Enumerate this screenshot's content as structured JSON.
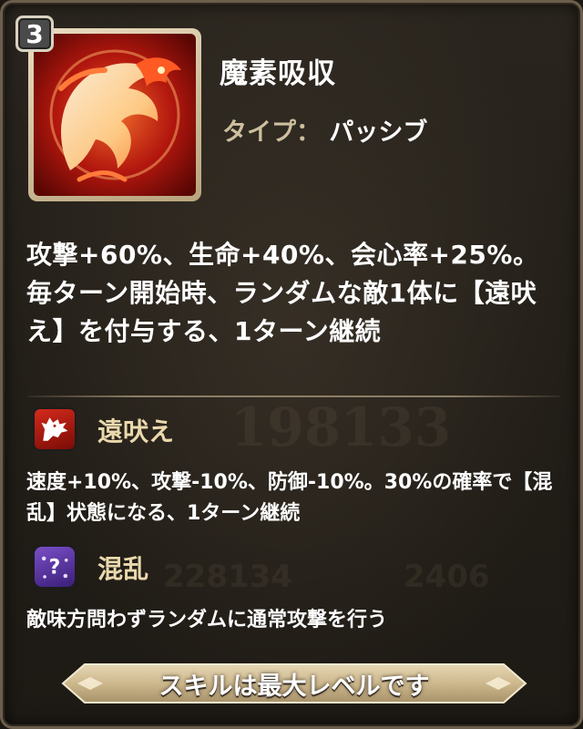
{
  "skill": {
    "level": "3",
    "name": "魔素吸収",
    "type_label": "タイプ：",
    "type_value": "パッシブ",
    "icon": "flame-dragon-icon",
    "description": "攻撃+60%、生命+40%、会心率+25%。毎ターン開始時、ランダムな敵1体に【遠吠え】を付与する、1ターン継続"
  },
  "effects": [
    {
      "name": "遠吠え",
      "icon": "wolf-howl-icon",
      "description": "速度+10%、攻撃-10%、防御-10%。30%の確率で【混乱】状態になる、1ターン継続"
    },
    {
      "name": "混乱",
      "icon": "confusion-icon",
      "description": "敵味方問わずランダムに通常攻撃を行う"
    }
  ],
  "footer": {
    "max_level_text": "スキルは最大レベルです"
  },
  "background": {
    "power": "198133",
    "stat_a": "228134",
    "stat_b": "2406"
  },
  "colors": {
    "panel_border": "#6d5f4c",
    "effect_name": "#ead9ad",
    "type_label": "#cdbf9f"
  }
}
